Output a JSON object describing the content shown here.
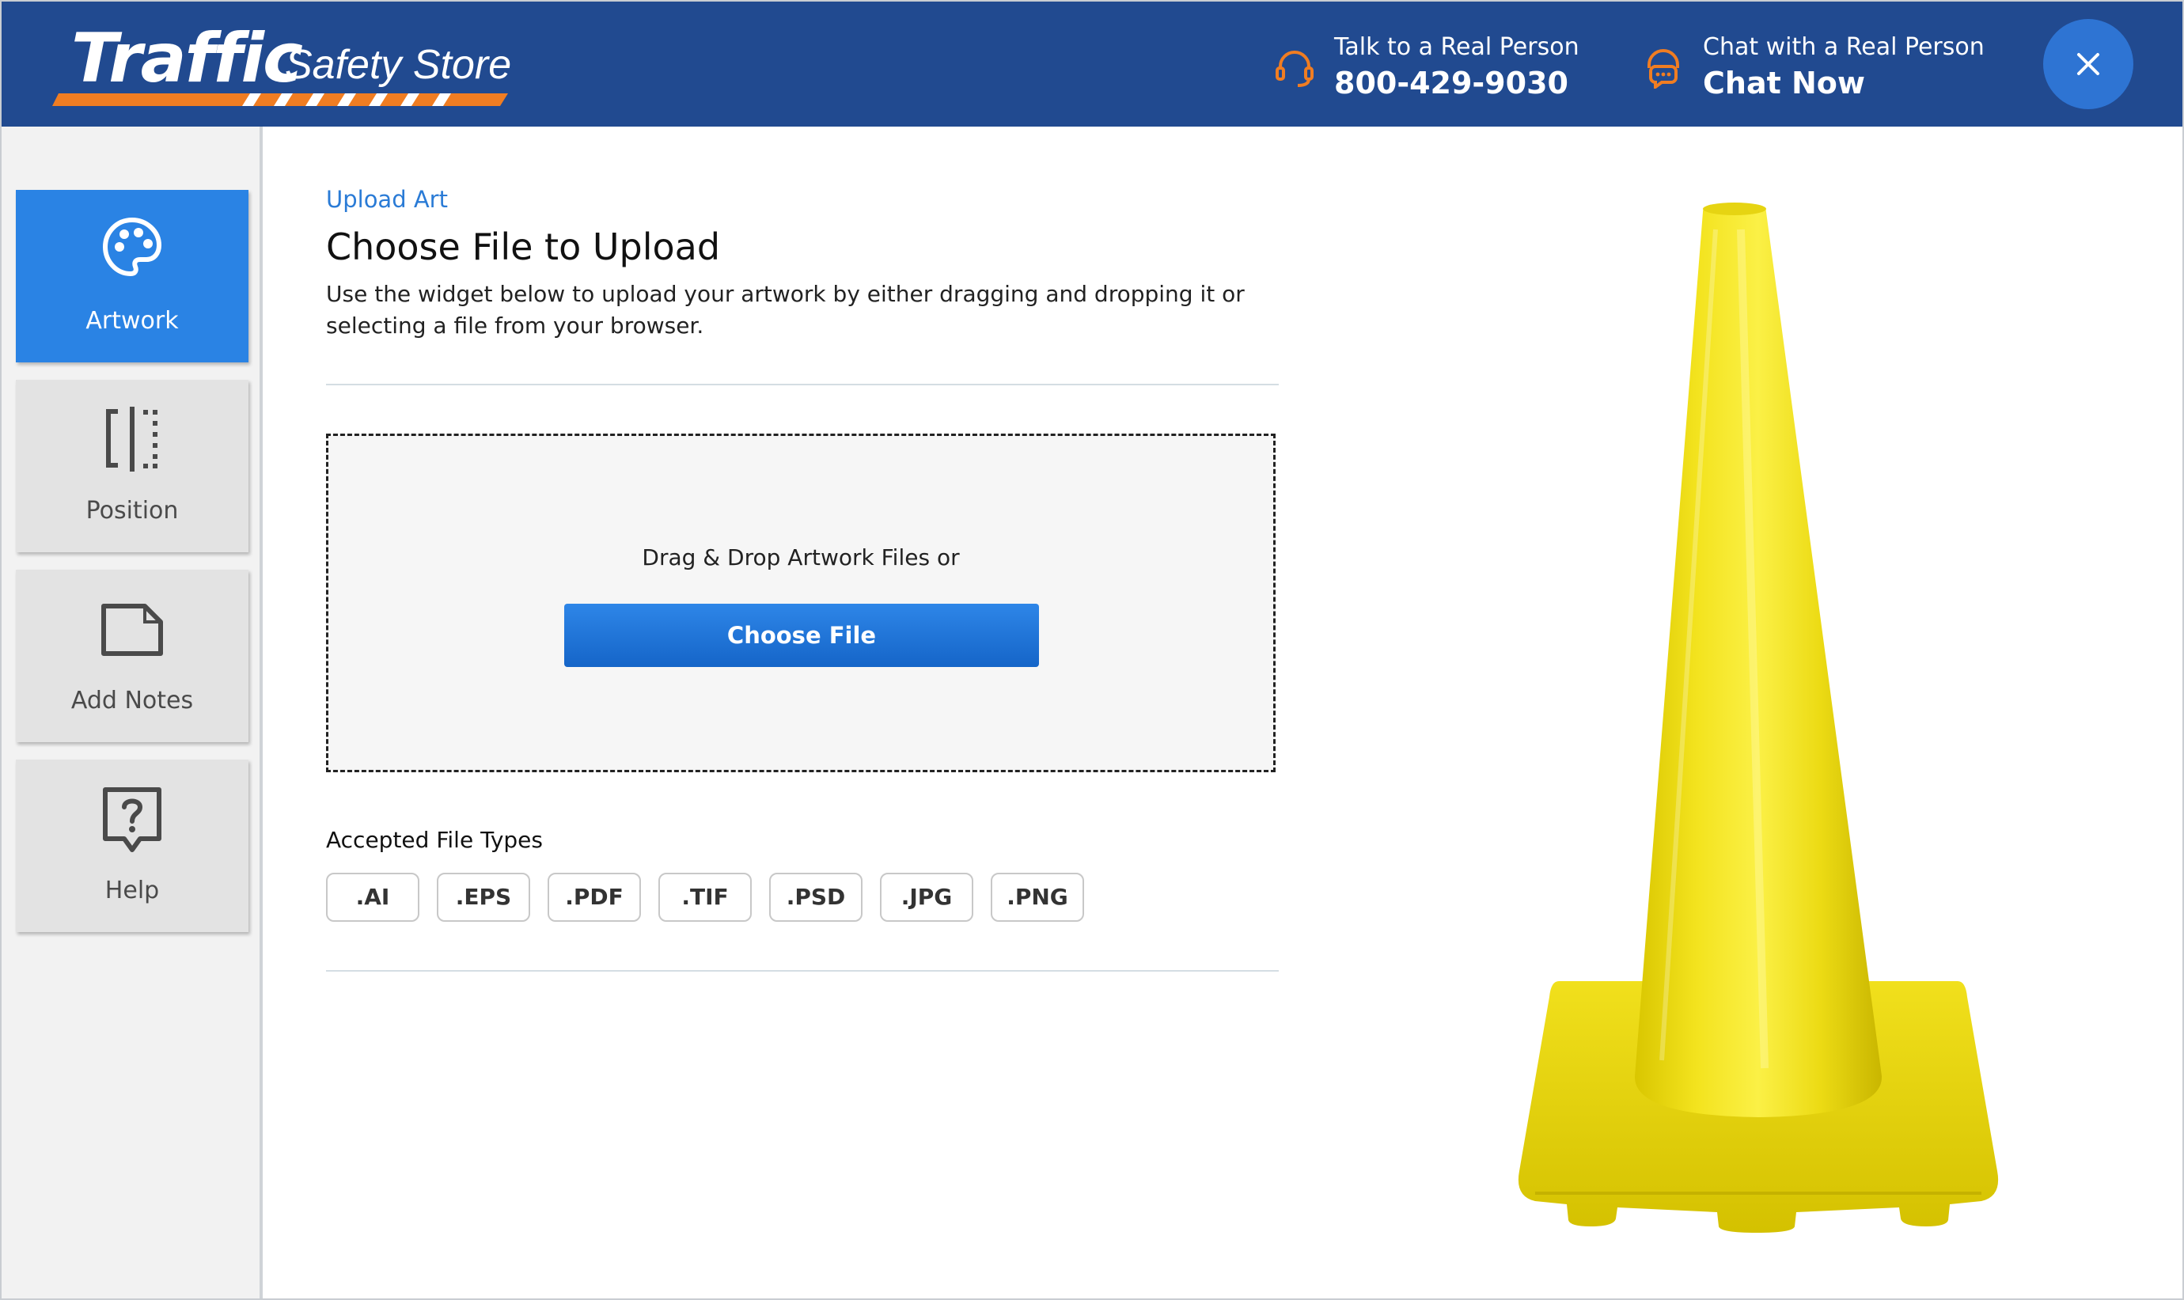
{
  "brand": {
    "name_main": "Traffic",
    "name_sub": "Safety Store"
  },
  "header": {
    "phone_label": "Talk to a Real Person",
    "phone_number": "800-429-9030",
    "chat_label": "Chat with a Real Person",
    "chat_action": "Chat Now",
    "close_icon": "close-icon"
  },
  "sidebar": {
    "items": [
      {
        "label": "Artwork",
        "icon": "palette-icon",
        "active": true
      },
      {
        "label": "Position",
        "icon": "position-icon",
        "active": false
      },
      {
        "label": "Add Notes",
        "icon": "note-icon",
        "active": false
      },
      {
        "label": "Help",
        "icon": "help-icon",
        "active": false
      }
    ]
  },
  "main": {
    "breadcrumb": "Upload Art",
    "title": "Choose File to Upload",
    "description": "Use the widget below to upload your artwork by either dragging and dropping it or selecting a file from your browser.",
    "dropzone_text": "Drag & Drop Artwork Files or",
    "choose_button": "Choose File",
    "accepted_label": "Accepted File Types",
    "file_types": [
      ".AI",
      ".EPS",
      ".PDF",
      ".TIF",
      ".PSD",
      ".JPG",
      ".PNG"
    ]
  },
  "colors": {
    "header_bg": "#214a90",
    "accent_orange": "#f07d22",
    "primary_blue": "#2a83e4",
    "close_button": "#2e74d3",
    "cone_yellow": "#f0e01a"
  },
  "product_image": "yellow-traffic-cone"
}
